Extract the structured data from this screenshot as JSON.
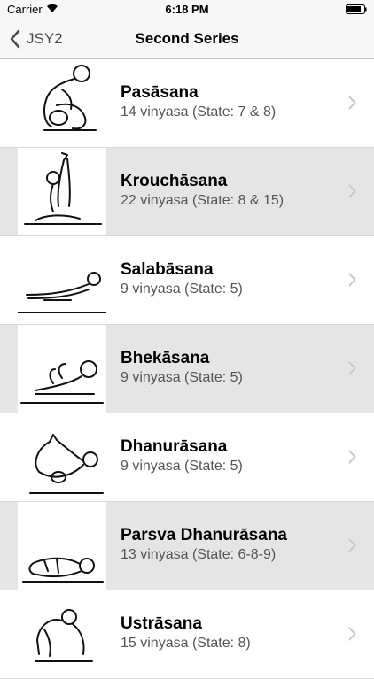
{
  "status_bar": {
    "carrier": "Carrier",
    "time": "6:18 PM"
  },
  "nav": {
    "back_label": "JSY2",
    "title": "Second Series"
  },
  "asanas": [
    {
      "name": "Pasāsana",
      "detail": "14 vinyasa (State: 7 & 8)",
      "icon": "pasasana-figure-icon"
    },
    {
      "name": "Krouchāsana",
      "detail": "22 vinyasa (State: 8 & 15)",
      "icon": "krouchasana-figure-icon"
    },
    {
      "name": "Salabāsana",
      "detail": "9 vinyasa (State: 5)",
      "icon": "salabasana-figure-icon"
    },
    {
      "name": "Bhekāsana",
      "detail": "9 vinyasa (State: 5)",
      "icon": "bhekasana-figure-icon"
    },
    {
      "name": "Dhanurāsana",
      "detail": "9 vinyasa (State: 5)",
      "icon": "dhanurasana-figure-icon"
    },
    {
      "name": "Parsva Dhanurāsana",
      "detail": "13 vinyasa (State: 6-8-9)",
      "icon": "parsva-dhanurasana-figure-icon"
    },
    {
      "name": "Ustrāsana",
      "detail": "15 vinyasa (State: 8)",
      "icon": "ustrasana-figure-icon"
    }
  ],
  "colors": {
    "row_alt": "#e5e5e5",
    "bar_bg": "#f7f7f7"
  }
}
